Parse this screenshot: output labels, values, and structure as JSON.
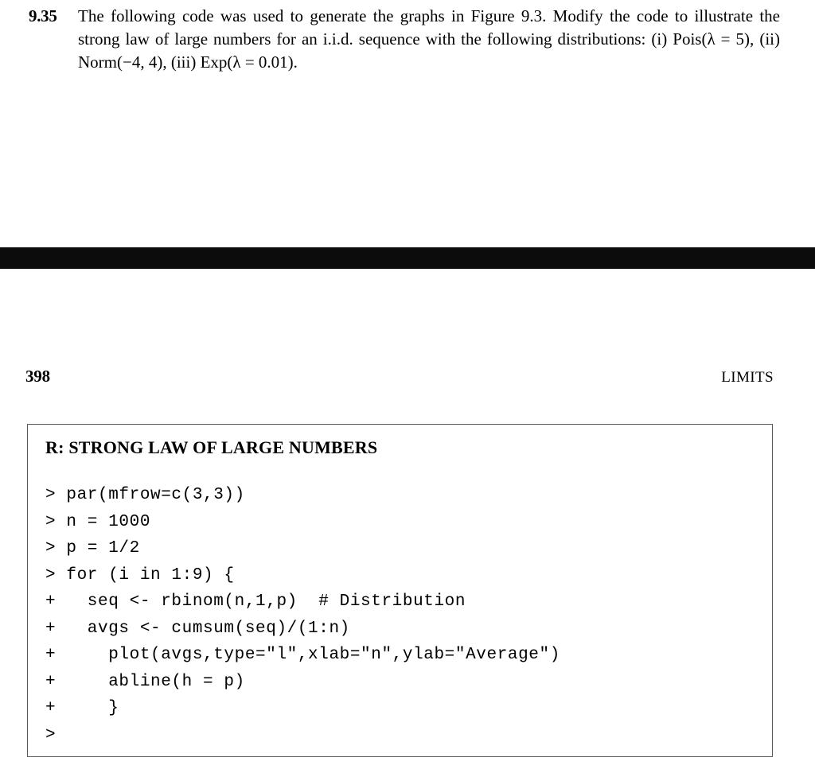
{
  "exercise": {
    "number": "9.35",
    "text_segments": [
      "The following code was used to generate the graphs in Figure 9.3. Modify the code to illustrate the strong law of large numbers for an i.i.d. sequence with the following distributions: (i) Pois(λ = 5), (ii) Norm(−4, 4), (iii) Exp(λ = 0.01)."
    ],
    "full_text": "The following code was used to generate the graphs in Figure 9.3. Modify the code to illustrate the strong law of large numbers for an i.i.d. sequence with the following distributions: (i) Pois(λ = 5), (ii) Norm(−4, 4), (iii) Exp(λ = 0.01)."
  },
  "running_head": {
    "page_number": "398",
    "title": "LIMITS"
  },
  "code_panel": {
    "title": "R: STRONG LAW OF LARGE NUMBERS",
    "lines": [
      "> par(mfrow=c(3,3))",
      "> n = 1000",
      "> p = 1/2",
      "> for (i in 1:9) {",
      "+   seq <- rbinom(n,1,p)  # Distribution",
      "+   avgs <- cumsum(seq)/(1:n)",
      "+     plot(avgs,type=\"l\",xlab=\"n\",ylab=\"Average\")",
      "+     abline(h = p)",
      "+     }",
      ">"
    ]
  },
  "colors": {
    "page_background": "#ffffff",
    "text": "#000000",
    "divider_bar": "#0c0c0c",
    "panel_border": "#5a5a5a"
  }
}
